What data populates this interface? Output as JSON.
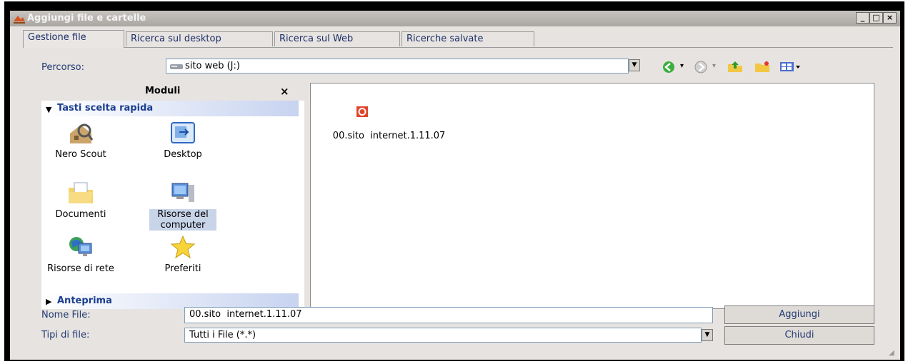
{
  "window": {
    "title": "Aggiungi file e cartelle"
  },
  "tabs": [
    {
      "label": "Gestione file",
      "active": true
    },
    {
      "label": "Ricerca sul desktop",
      "active": false
    },
    {
      "label": "Ricerca sul Web",
      "active": false
    },
    {
      "label": "Ricerche salvate",
      "active": false
    }
  ],
  "path": {
    "label": "Percorso:",
    "value": "sito web (J:)"
  },
  "modules": {
    "title": "Moduli",
    "close": "×",
    "shortcuts_header": "Tasti scelta rapida",
    "preview_header": "Anteprima",
    "items": [
      {
        "label": "Nero Scout",
        "icon": "nero-scout-icon"
      },
      {
        "label": "Desktop",
        "icon": "desktop-icon"
      },
      {
        "label": "Documenti",
        "icon": "documents-folder-icon"
      },
      {
        "label": "Risorse del computer",
        "icon": "my-computer-icon"
      },
      {
        "label": "Risorse di rete",
        "icon": "network-icon"
      },
      {
        "label": "Preferiti",
        "icon": "favorites-star-icon"
      }
    ]
  },
  "file_list": [
    {
      "name": "00.sito  internet.1.11.07",
      "icon": "nero-file-icon"
    }
  ],
  "filename": {
    "label": "Nome File:",
    "value": "00.sito  internet.1.11.07"
  },
  "filetype": {
    "label": "Tipi di file:",
    "value": "Tutti i File (*.*)"
  },
  "buttons": {
    "add": "Aggiungi",
    "close": "Chiudi"
  }
}
